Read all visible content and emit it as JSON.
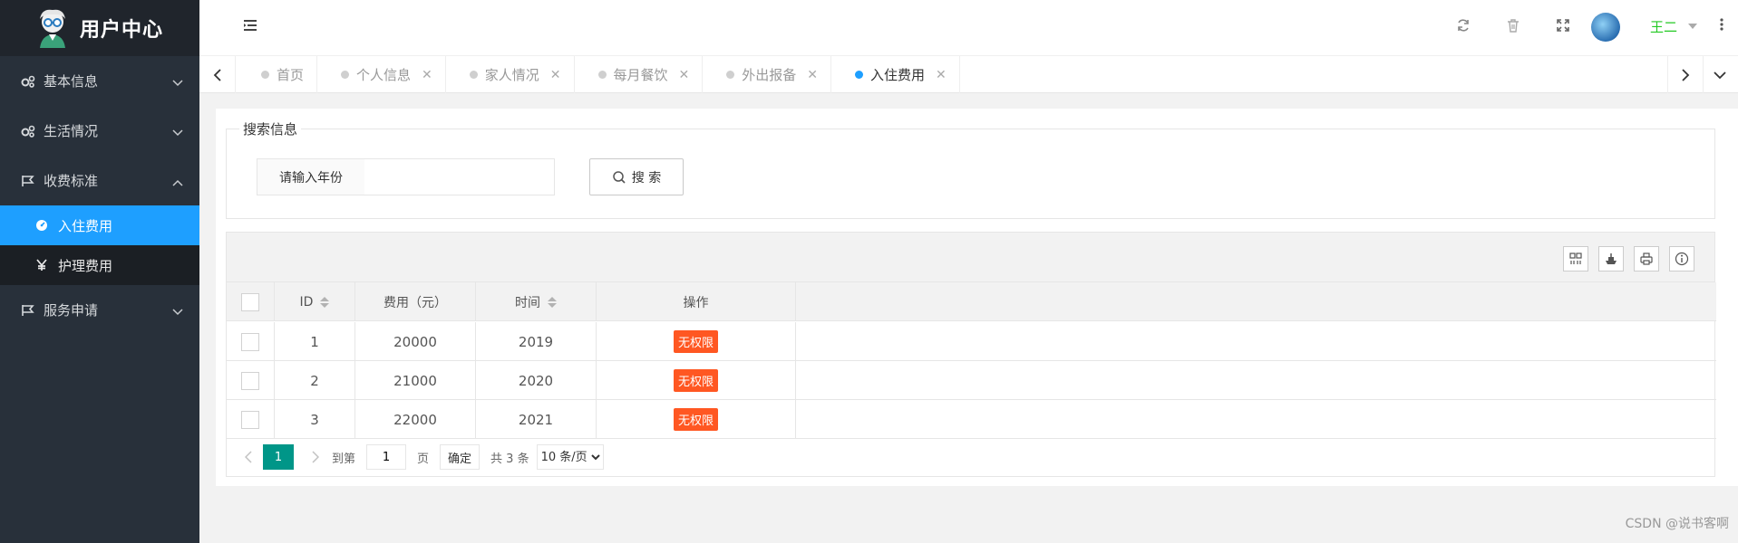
{
  "app": {
    "title": "用户中心"
  },
  "sidebar": {
    "items": [
      {
        "label": "基本信息"
      },
      {
        "label": "生活情况"
      },
      {
        "label": "收费标准"
      }
    ],
    "sub_items": [
      {
        "label": "入住费用"
      },
      {
        "label": "护理费用"
      }
    ],
    "last_item": {
      "label": "服务申请"
    }
  },
  "header": {
    "user_name": "王二"
  },
  "tabs": [
    {
      "label": "首页"
    },
    {
      "label": "个人信息"
    },
    {
      "label": "家人情况"
    },
    {
      "label": "每月餐饮"
    },
    {
      "label": "外出报备"
    },
    {
      "label": "入住费用"
    }
  ],
  "search": {
    "legend": "搜索信息",
    "label": "请输入年份",
    "value": "",
    "button": "搜 索"
  },
  "table": {
    "columns": [
      "ID",
      "费用（元）",
      "时间",
      "操作"
    ],
    "rows": [
      {
        "id": "1",
        "fee": "20000",
        "year": "2019",
        "action": "无权限"
      },
      {
        "id": "2",
        "fee": "21000",
        "year": "2020",
        "action": "无权限"
      },
      {
        "id": "3",
        "fee": "22000",
        "year": "2021",
        "action": "无权限"
      }
    ]
  },
  "pager": {
    "current": "1",
    "goto_label": "到第",
    "goto_value": "1",
    "page_unit": "页",
    "confirm": "确定",
    "total": "共 3 条",
    "page_size": "10 条/页"
  },
  "watermark": "CSDN @说书客啊",
  "colors": {
    "accent": "#1e9fff",
    "danger": "#ff5722",
    "pager": "#009688",
    "sidebar": "#28303a"
  }
}
